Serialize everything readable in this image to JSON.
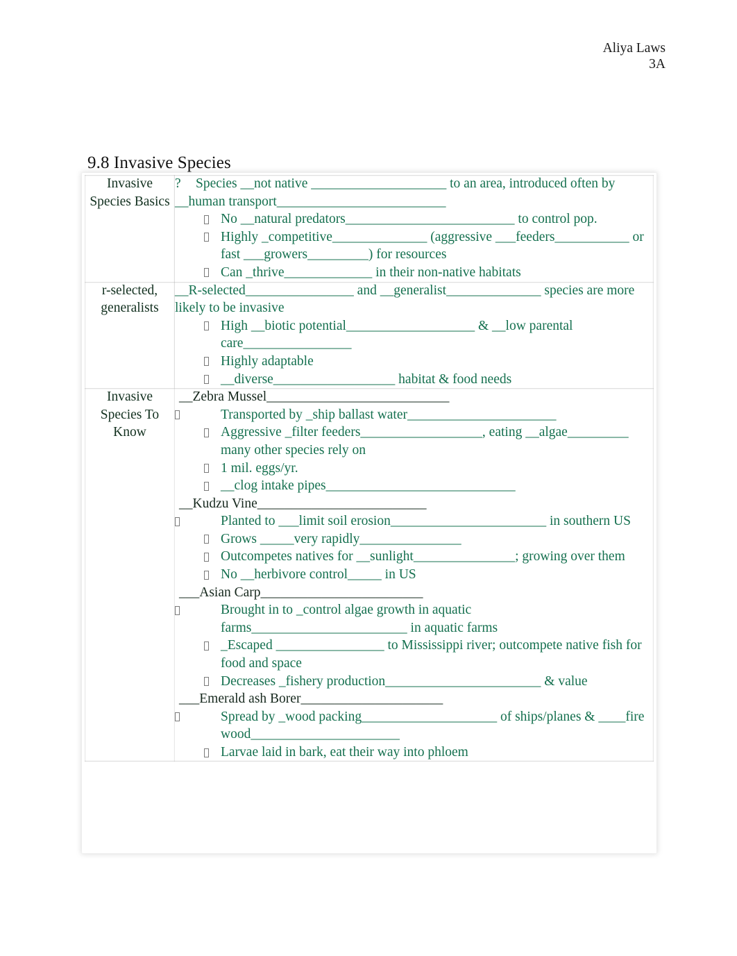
{
  "header": {
    "name": "Aliya Laws",
    "section": "3A"
  },
  "title": "9.8 Invasive Species",
  "colors": {
    "body_green": "#15704f",
    "heading_dark": "#16281d",
    "page_background": "#ffffff",
    "table_border": "#969696"
  },
  "table": {
    "rows": [
      {
        "label": "Invasive Species Basics",
        "lead": {
          "marker": "?",
          "text": "Species __not native ____________________ to an area, introduced often by __human transport_________________________"
        },
        "bullets": [
          "No __natural predators_________________________ to control pop.",
          "Highly _competitive______________ (aggressive ___feeders___________ or fast ___growers_________) for resources",
          "Can _thrive_____________ in their non-native habitats"
        ]
      },
      {
        "label": "r-selected, generalists",
        "lead": {
          "marker": "",
          "text": "__R-selected________________ and __generalist______________ species are more likely to be invasive"
        },
        "bullets": [
          "High __biotic potential___________________ & __low parental care________________",
          "Highly adaptable",
          "__diverse__________________ habitat & food needs"
        ]
      },
      {
        "label": "Invasive Species To Know",
        "lead": {
          "marker": "",
          "text": ""
        },
        "groups": [
          {
            "heading": "__Zebra Mussel___________________________",
            "bullets": [
              {
                "wide": true,
                "text": "Transported by _ship ballast water______________________"
              },
              {
                "wide": false,
                "text": "Aggressive _filter feeders__________________, eating __algae_________ many other species rely on"
              },
              {
                "wide": false,
                "text": "1 mil. eggs/yr."
              },
              {
                "wide": false,
                "text": "__clog intake pipes____________________________"
              }
            ]
          },
          {
            "heading": "__Kudzu Vine_________________________",
            "bullets": [
              {
                "wide": true,
                "text": "Planted to ___limit soil erosion_______________________ in southern US"
              },
              {
                "wide": false,
                "text": "Grows _____very rapidly_______________"
              },
              {
                "wide": false,
                "text": "Outcompetes natives for __sunlight_______________; growing over them"
              },
              {
                "wide": false,
                "text": "No __herbivore control_____ in US"
              }
            ]
          },
          {
            "heading": "___Asian Carp________________________",
            "bullets": [
              {
                "wide": true,
                "text": "Brought in to _control algae growth in aquatic farms_______________________ in aquatic farms"
              },
              {
                "wide": false,
                "text": "_Escaped ________________ to Mississippi river; outcompete native fish for food and space"
              },
              {
                "wide": false,
                "text": "Decreases _fishery production_______________________ & value"
              }
            ]
          },
          {
            "heading": "___Emerald ash Borer_____________________",
            "bullets": [
              {
                "wide": true,
                "text": "Spread by _wood packing____________________ of ships/planes & ____fire wood______________________"
              },
              {
                "wide": false,
                "text": "Larvae laid in bark, eat their way into phloem"
              }
            ]
          }
        ]
      }
    ]
  }
}
